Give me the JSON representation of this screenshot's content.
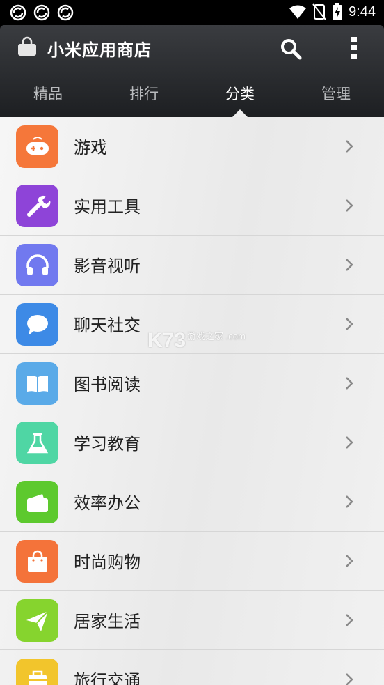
{
  "status_bar": {
    "time": "9:44",
    "left_icons": [
      "sync-icon",
      "sync-icon",
      "sync-icon"
    ],
    "right_icons": [
      "wifi-icon",
      "no-sim-icon",
      "battery-charging-icon"
    ]
  },
  "app": {
    "title": "小米应用商店",
    "icons": [
      "store-bag-icon",
      "search-icon",
      "overflow-menu-icon"
    ]
  },
  "tabs": [
    {
      "label": "精品",
      "active": false
    },
    {
      "label": "排行",
      "active": false
    },
    {
      "label": "分类",
      "active": true
    },
    {
      "label": "管理",
      "active": false
    }
  ],
  "categories": [
    {
      "label": "游戏",
      "icon": "gamepad-icon",
      "color": "#f5773a"
    },
    {
      "label": "实用工具",
      "icon": "wrench-icon",
      "color": "#8e44d8"
    },
    {
      "label": "影音视听",
      "icon": "headphones-icon",
      "color": "#7179ef"
    },
    {
      "label": "聊天社交",
      "icon": "chat-bubble-icon",
      "color": "#3d8ae6"
    },
    {
      "label": "图书阅读",
      "icon": "book-icon",
      "color": "#5aaae8"
    },
    {
      "label": "学习教育",
      "icon": "flask-icon",
      "color": "#4fd6a4"
    },
    {
      "label": "效率办公",
      "icon": "wallet-icon",
      "color": "#5dc92e"
    },
    {
      "label": "时尚购物",
      "icon": "shopping-bag-icon",
      "color": "#f4733a"
    },
    {
      "label": "居家生活",
      "icon": "paper-plane-icon",
      "color": "#86d42e"
    },
    {
      "label": "旅行交通",
      "icon": "suitcase-icon",
      "color": "#f2c52c"
    }
  ],
  "watermark": {
    "text": "K73",
    "sub": "游戏之家 .com"
  }
}
